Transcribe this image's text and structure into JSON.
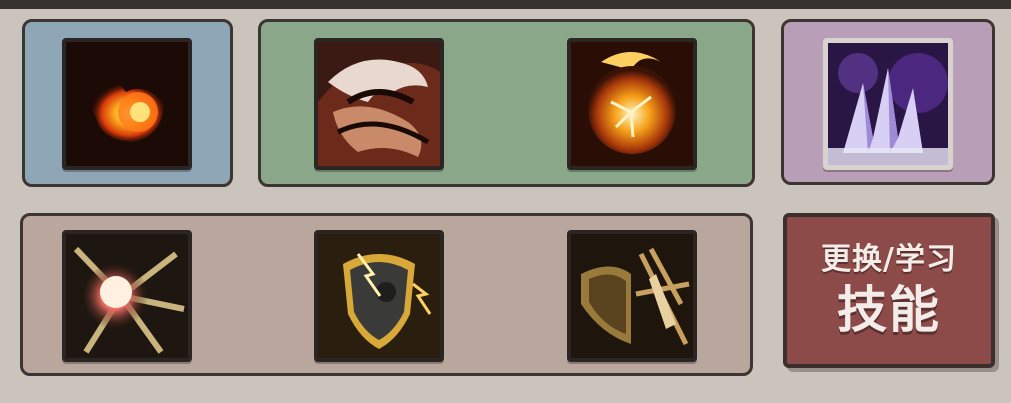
{
  "skill_slots": [
    {
      "icon": "fireball-icon",
      "group": "blue"
    },
    {
      "icon": "dragon-breath-icon",
      "group": "green"
    },
    {
      "icon": "flame-orb-icon",
      "group": "green"
    },
    {
      "icon": "ice-crystal-icon",
      "group": "purple"
    },
    {
      "icon": "light-burst-icon",
      "group": "brown"
    },
    {
      "icon": "lightning-shield-icon",
      "group": "brown"
    },
    {
      "icon": "sword-shield-icon",
      "group": "brown"
    }
  ],
  "button": {
    "line1": "更换/学习",
    "line2": "技能"
  },
  "colors": {
    "blue_panel": "#8fa6b6",
    "green_panel": "#8aa889",
    "purple_panel": "#b89eb6",
    "brown_panel": "#b9a69d",
    "button": "#8c4a48"
  }
}
